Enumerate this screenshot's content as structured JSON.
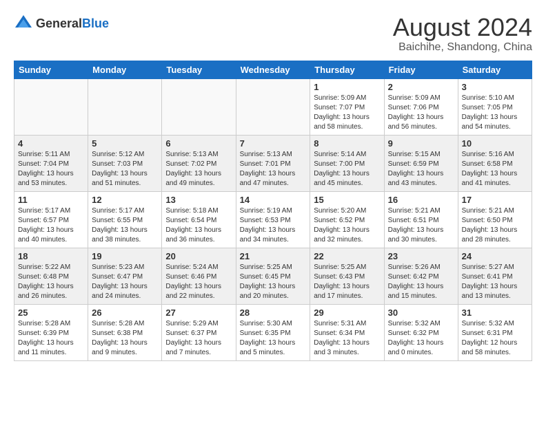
{
  "header": {
    "logo_general": "General",
    "logo_blue": "Blue",
    "main_title": "August 2024",
    "subtitle": "Baichihe, Shandong, China"
  },
  "weekdays": [
    "Sunday",
    "Monday",
    "Tuesday",
    "Wednesday",
    "Thursday",
    "Friday",
    "Saturday"
  ],
  "weeks": [
    [
      {
        "day": "",
        "info": ""
      },
      {
        "day": "",
        "info": ""
      },
      {
        "day": "",
        "info": ""
      },
      {
        "day": "",
        "info": ""
      },
      {
        "day": "1",
        "info": "Sunrise: 5:09 AM\nSunset: 7:07 PM\nDaylight: 13 hours\nand 58 minutes."
      },
      {
        "day": "2",
        "info": "Sunrise: 5:09 AM\nSunset: 7:06 PM\nDaylight: 13 hours\nand 56 minutes."
      },
      {
        "day": "3",
        "info": "Sunrise: 5:10 AM\nSunset: 7:05 PM\nDaylight: 13 hours\nand 54 minutes."
      }
    ],
    [
      {
        "day": "4",
        "info": "Sunrise: 5:11 AM\nSunset: 7:04 PM\nDaylight: 13 hours\nand 53 minutes."
      },
      {
        "day": "5",
        "info": "Sunrise: 5:12 AM\nSunset: 7:03 PM\nDaylight: 13 hours\nand 51 minutes."
      },
      {
        "day": "6",
        "info": "Sunrise: 5:13 AM\nSunset: 7:02 PM\nDaylight: 13 hours\nand 49 minutes."
      },
      {
        "day": "7",
        "info": "Sunrise: 5:13 AM\nSunset: 7:01 PM\nDaylight: 13 hours\nand 47 minutes."
      },
      {
        "day": "8",
        "info": "Sunrise: 5:14 AM\nSunset: 7:00 PM\nDaylight: 13 hours\nand 45 minutes."
      },
      {
        "day": "9",
        "info": "Sunrise: 5:15 AM\nSunset: 6:59 PM\nDaylight: 13 hours\nand 43 minutes."
      },
      {
        "day": "10",
        "info": "Sunrise: 5:16 AM\nSunset: 6:58 PM\nDaylight: 13 hours\nand 41 minutes."
      }
    ],
    [
      {
        "day": "11",
        "info": "Sunrise: 5:17 AM\nSunset: 6:57 PM\nDaylight: 13 hours\nand 40 minutes."
      },
      {
        "day": "12",
        "info": "Sunrise: 5:17 AM\nSunset: 6:55 PM\nDaylight: 13 hours\nand 38 minutes."
      },
      {
        "day": "13",
        "info": "Sunrise: 5:18 AM\nSunset: 6:54 PM\nDaylight: 13 hours\nand 36 minutes."
      },
      {
        "day": "14",
        "info": "Sunrise: 5:19 AM\nSunset: 6:53 PM\nDaylight: 13 hours\nand 34 minutes."
      },
      {
        "day": "15",
        "info": "Sunrise: 5:20 AM\nSunset: 6:52 PM\nDaylight: 13 hours\nand 32 minutes."
      },
      {
        "day": "16",
        "info": "Sunrise: 5:21 AM\nSunset: 6:51 PM\nDaylight: 13 hours\nand 30 minutes."
      },
      {
        "day": "17",
        "info": "Sunrise: 5:21 AM\nSunset: 6:50 PM\nDaylight: 13 hours\nand 28 minutes."
      }
    ],
    [
      {
        "day": "18",
        "info": "Sunrise: 5:22 AM\nSunset: 6:48 PM\nDaylight: 13 hours\nand 26 minutes."
      },
      {
        "day": "19",
        "info": "Sunrise: 5:23 AM\nSunset: 6:47 PM\nDaylight: 13 hours\nand 24 minutes."
      },
      {
        "day": "20",
        "info": "Sunrise: 5:24 AM\nSunset: 6:46 PM\nDaylight: 13 hours\nand 22 minutes."
      },
      {
        "day": "21",
        "info": "Sunrise: 5:25 AM\nSunset: 6:45 PM\nDaylight: 13 hours\nand 20 minutes."
      },
      {
        "day": "22",
        "info": "Sunrise: 5:25 AM\nSunset: 6:43 PM\nDaylight: 13 hours\nand 17 minutes."
      },
      {
        "day": "23",
        "info": "Sunrise: 5:26 AM\nSunset: 6:42 PM\nDaylight: 13 hours\nand 15 minutes."
      },
      {
        "day": "24",
        "info": "Sunrise: 5:27 AM\nSunset: 6:41 PM\nDaylight: 13 hours\nand 13 minutes."
      }
    ],
    [
      {
        "day": "25",
        "info": "Sunrise: 5:28 AM\nSunset: 6:39 PM\nDaylight: 13 hours\nand 11 minutes."
      },
      {
        "day": "26",
        "info": "Sunrise: 5:28 AM\nSunset: 6:38 PM\nDaylight: 13 hours\nand 9 minutes."
      },
      {
        "day": "27",
        "info": "Sunrise: 5:29 AM\nSunset: 6:37 PM\nDaylight: 13 hours\nand 7 minutes."
      },
      {
        "day": "28",
        "info": "Sunrise: 5:30 AM\nSunset: 6:35 PM\nDaylight: 13 hours\nand 5 minutes."
      },
      {
        "day": "29",
        "info": "Sunrise: 5:31 AM\nSunset: 6:34 PM\nDaylight: 13 hours\nand 3 minutes."
      },
      {
        "day": "30",
        "info": "Sunrise: 5:32 AM\nSunset: 6:32 PM\nDaylight: 13 hours\nand 0 minutes."
      },
      {
        "day": "31",
        "info": "Sunrise: 5:32 AM\nSunset: 6:31 PM\nDaylight: 12 hours\nand 58 minutes."
      }
    ]
  ]
}
